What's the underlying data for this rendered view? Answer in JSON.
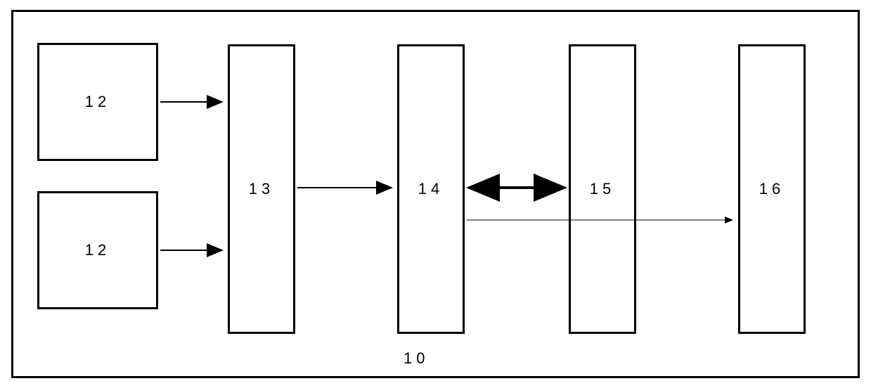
{
  "container": {
    "label": "10"
  },
  "blocks": {
    "block_12a": {
      "label": "12"
    },
    "block_12b": {
      "label": "12"
    },
    "block_13": {
      "label": "13"
    },
    "block_14": {
      "label": "14"
    },
    "block_15": {
      "label": "15"
    },
    "block_16": {
      "label": "16"
    }
  },
  "connectors": [
    {
      "from": "block_12a",
      "to": "block_13",
      "type": "arrow"
    },
    {
      "from": "block_12b",
      "to": "block_13",
      "type": "arrow"
    },
    {
      "from": "block_13",
      "to": "block_14",
      "type": "arrow"
    },
    {
      "from": "block_14",
      "to": "block_15",
      "type": "double-arrow"
    },
    {
      "from": "block_14",
      "to": "block_16",
      "type": "thin-arrow"
    }
  ]
}
